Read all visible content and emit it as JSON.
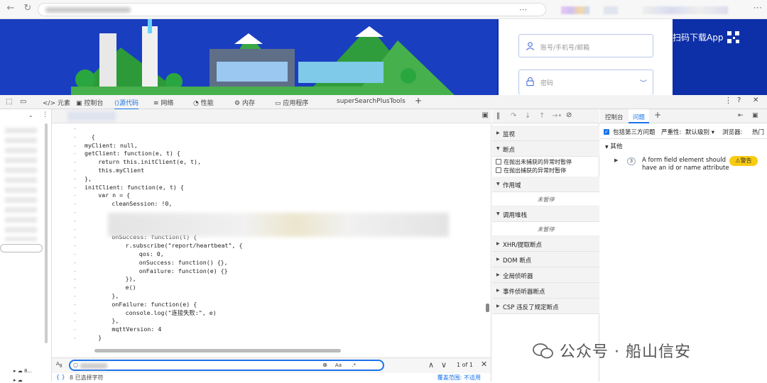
{
  "browser": {
    "more_glyph": "⋯"
  },
  "page": {
    "username_placeholder": "账号/手机号/邮箱",
    "password_placeholder": "密码",
    "app_download": "扫码下载App"
  },
  "devtools": {
    "tabs": [
      "元素",
      "控制台",
      "源代码",
      "网络",
      "性能",
      "内存",
      "应用程序",
      "superSearchPlusTools"
    ],
    "active_tab": "源代码",
    "add_tab": "+"
  },
  "editor": {
    "code_lines": [
      {
        "indent": 0,
        "text": ""
      },
      {
        "indent": 1,
        "text": "{"
      },
      {
        "indent": 0,
        "text": "myClient: null,"
      },
      {
        "indent": 0,
        "text": "getClient: function(e, t) {"
      },
      {
        "indent": 2,
        "text": "return this.initClient(e, t),"
      },
      {
        "indent": 2,
        "text": "this.myClient"
      },
      {
        "indent": 0,
        "text": "},"
      },
      {
        "indent": 0,
        "text": "initClient: function(e, t) {"
      },
      {
        "indent": 2,
        "text": "var n = {"
      },
      {
        "indent": 4,
        "text": "cleanSession: !0,"
      },
      {
        "indent": 0,
        "text": ""
      },
      {
        "indent": 0,
        "text": ""
      },
      {
        "indent": 0,
        "text": ""
      },
      {
        "indent": 4,
        "text": "onSuccess: function(t) {"
      },
      {
        "indent": 6,
        "text": "r.subscribe(\"report/heartbeat\", {"
      },
      {
        "indent": 8,
        "text": "qos: 0,"
      },
      {
        "indent": 8,
        "text": "onSuccess: function() {},"
      },
      {
        "indent": 8,
        "text": "onFailure: function(e) {}"
      },
      {
        "indent": 6,
        "text": "}),"
      },
      {
        "indent": 6,
        "text": "e()"
      },
      {
        "indent": 4,
        "text": "},"
      },
      {
        "indent": 4,
        "text": "onFailure: function(e) {"
      },
      {
        "indent": 6,
        "text": "console.log(\"连接失败:\", e)"
      },
      {
        "indent": 4,
        "text": "},"
      },
      {
        "indent": 4,
        "text": "mqttVersion: 4"
      },
      {
        "indent": 2,
        "text": "}"
      }
    ]
  },
  "search": {
    "match_case": "Aa",
    "regex": ".*",
    "count": "1 of 1",
    "status_left": "8 已选择字符",
    "status_right": "覆盖范围: 不适用"
  },
  "debugger": {
    "sections": [
      {
        "label": "监视",
        "expanded": false
      },
      {
        "label": "断点",
        "expanded": true
      },
      {
        "label": "作用域",
        "expanded": true
      },
      {
        "label": "调用堆栈",
        "expanded": true
      },
      {
        "label": "XHR/提取断点",
        "expanded": false
      },
      {
        "label": "DOM 断点",
        "expanded": false
      },
      {
        "label": "全局侦听器",
        "expanded": false
      },
      {
        "label": "事件侦听器断点",
        "expanded": false
      },
      {
        "label": "CSP 违反了规定断点",
        "expanded": false
      }
    ],
    "pause_uncaught": "在抛出未捕获的异常时暂停",
    "pause_caught": "在抛出捕获的异常时暂停",
    "not_paused": "未暂停"
  },
  "issues": {
    "tabs": [
      "控制台",
      "问题"
    ],
    "active_tab": "问题",
    "third_party": "包括第三方问题",
    "severity_label": "严重性:",
    "severity_value": "默认级别",
    "browser_label": "浏览器:",
    "browser_value": "热门",
    "group": "其他",
    "issue_count": "3",
    "issue_text_1": "A form field element should",
    "issue_text_2": "have an id or name attribute",
    "badge": "警告"
  },
  "watermark": "公众号 · 船山信安",
  "colors": {
    "accent": "#1a73e8",
    "hero_bg": "#0d2fa8",
    "warning_bg": "#f9cb12"
  }
}
